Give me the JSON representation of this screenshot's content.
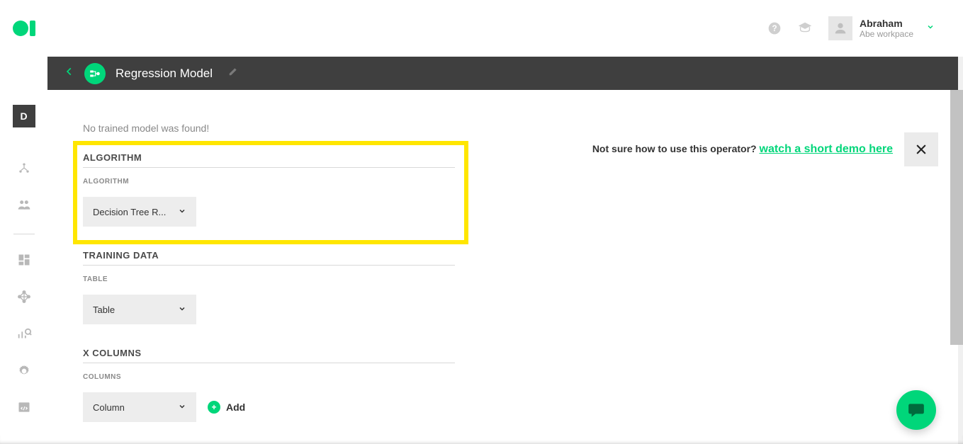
{
  "header": {
    "user_name": "Abraham",
    "user_workspace": "Abe workpace"
  },
  "sidebar": {
    "badge": "D"
  },
  "titlebar": {
    "title": "Regression Model"
  },
  "content": {
    "no_model_msg": "No trained model was found!",
    "hint_prefix": "Not sure how to use this operator? ",
    "hint_link": "watch a short demo here"
  },
  "sections": {
    "algorithm": {
      "header": "ALGORITHM",
      "label": "ALGORITHM",
      "select_value": "Decision Tree R..."
    },
    "training_data": {
      "header": "TRAINING DATA",
      "label": "TABLE",
      "select_value": "Table"
    },
    "x_columns": {
      "header": "X COLUMNS",
      "label": "COLUMNS",
      "select_value": "Column",
      "add_label": "Add"
    }
  }
}
